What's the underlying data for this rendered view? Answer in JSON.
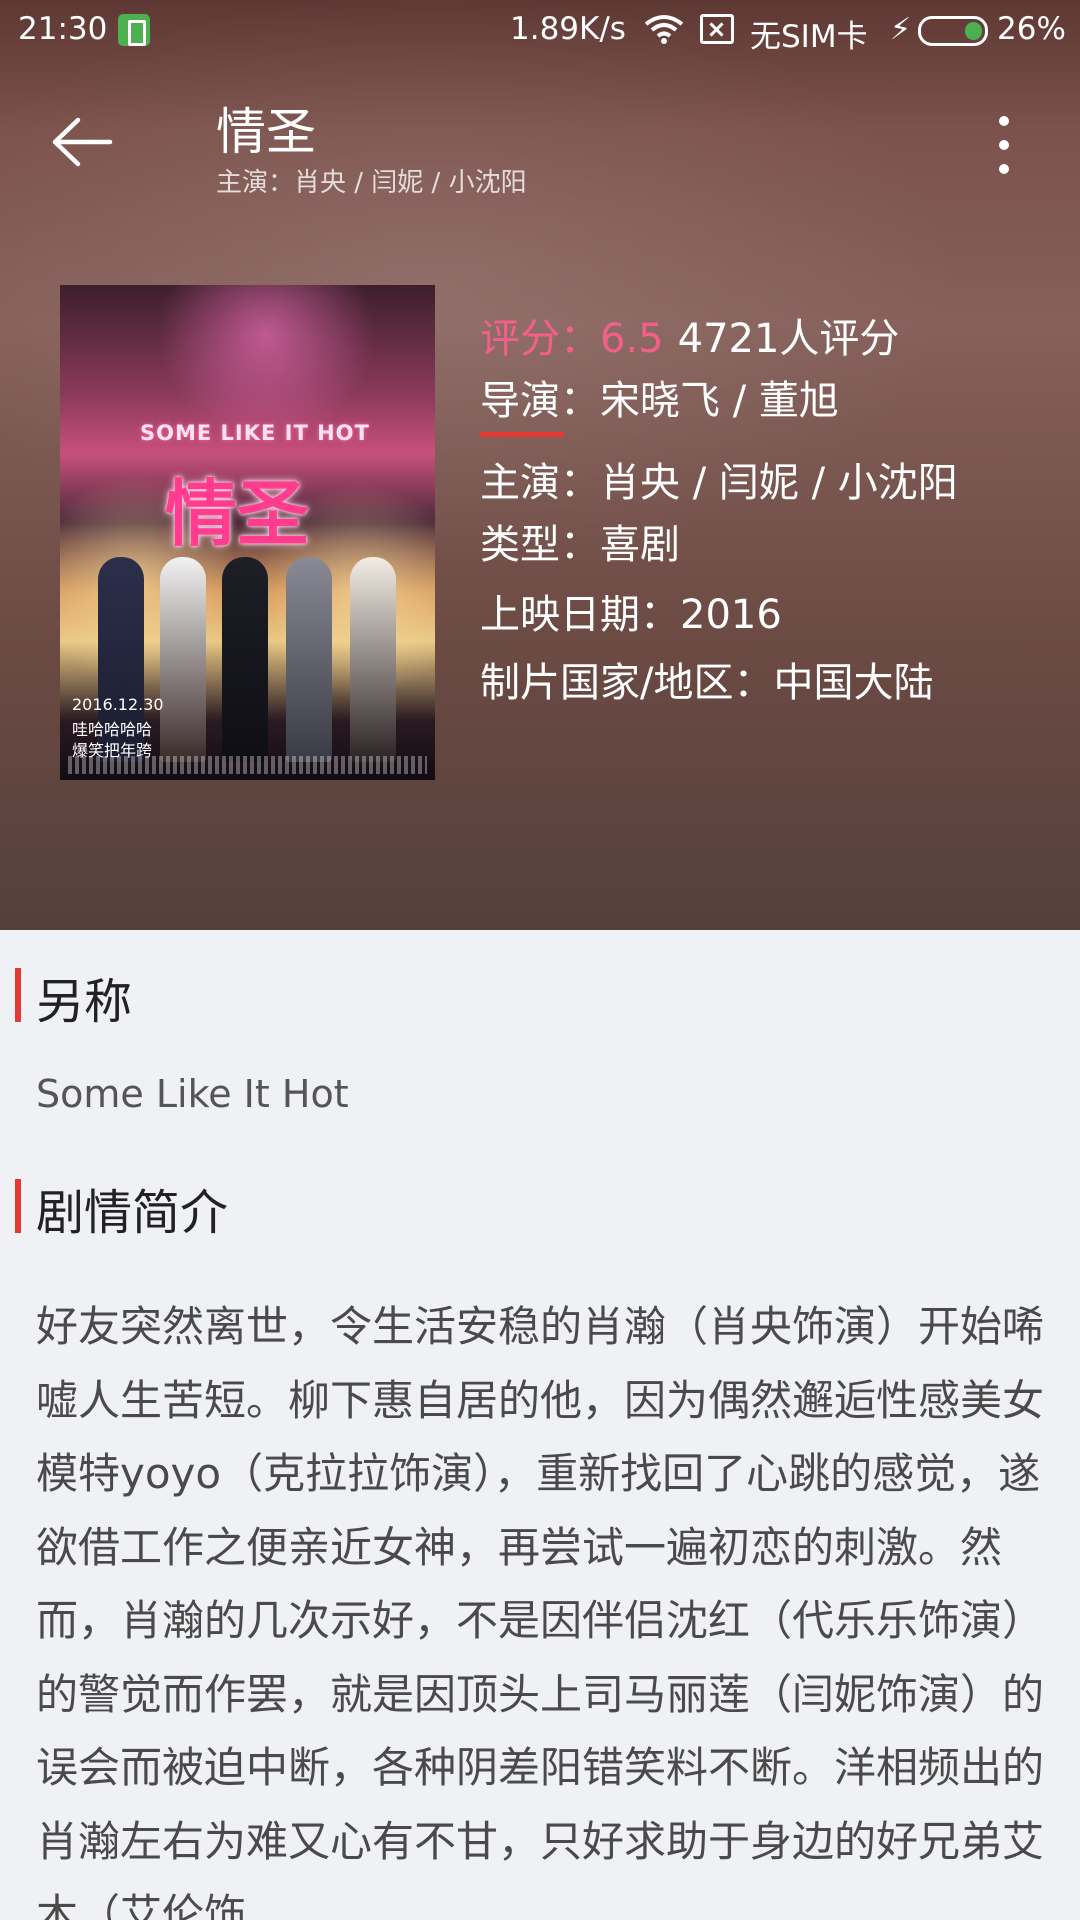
{
  "status_bar": {
    "time": "21:30",
    "network_speed": "1.89K/s",
    "sim_status": "无SIM卡",
    "battery_percent": "26%",
    "battery_level": 0.26
  },
  "toolbar": {
    "title": "情圣",
    "subtitle": "主演：肖央 / 闫妮 / 小沈阳"
  },
  "poster": {
    "title_cn": "情圣",
    "title_en": "SOME LIKE IT HOT",
    "date": "2016.12.30",
    "tagline_1": "哇哈哈哈哈",
    "tagline_2": "爆笑把年跨"
  },
  "info": {
    "rating_label": "评分：6.5",
    "rating_count": "4721人评分",
    "director": "导演：宋晓飞  / 董旭",
    "cast": "主演：肖央 / 闫妮 / 小沈阳",
    "genre": "类型：喜剧",
    "release": "上映日期：2016",
    "country": "制片国家/地区：中国大陆"
  },
  "alias_section": {
    "title": "另称",
    "value": "Some Like It Hot"
  },
  "synopsis_section": {
    "title": "剧情简介",
    "text": "好友突然离世，令生活安稳的肖瀚（肖央饰演）开始唏嘘人生苦短。柳下惠自居的他，因为偶然邂逅性感美女模特yoyo（克拉拉饰演），重新找回了心跳的感觉，遂欲借工作之便亲近女神，再尝试一遍初恋的刺激。然而，肖瀚的几次示好，不是因伴侣沈红（代乐乐饰演）的警觉而作罢，就是因顶头上司马丽莲（闫妮饰演）的误会而被迫中断，各种阴差阳错笑料不断。洋相频出的肖瀚左右为难又心有不甘，只好求助于身边的好兄弟艾木（艾伦饰"
  },
  "colors": {
    "accent": "#e53935",
    "rating": "#f2608a",
    "background": "#f0f1f4"
  }
}
